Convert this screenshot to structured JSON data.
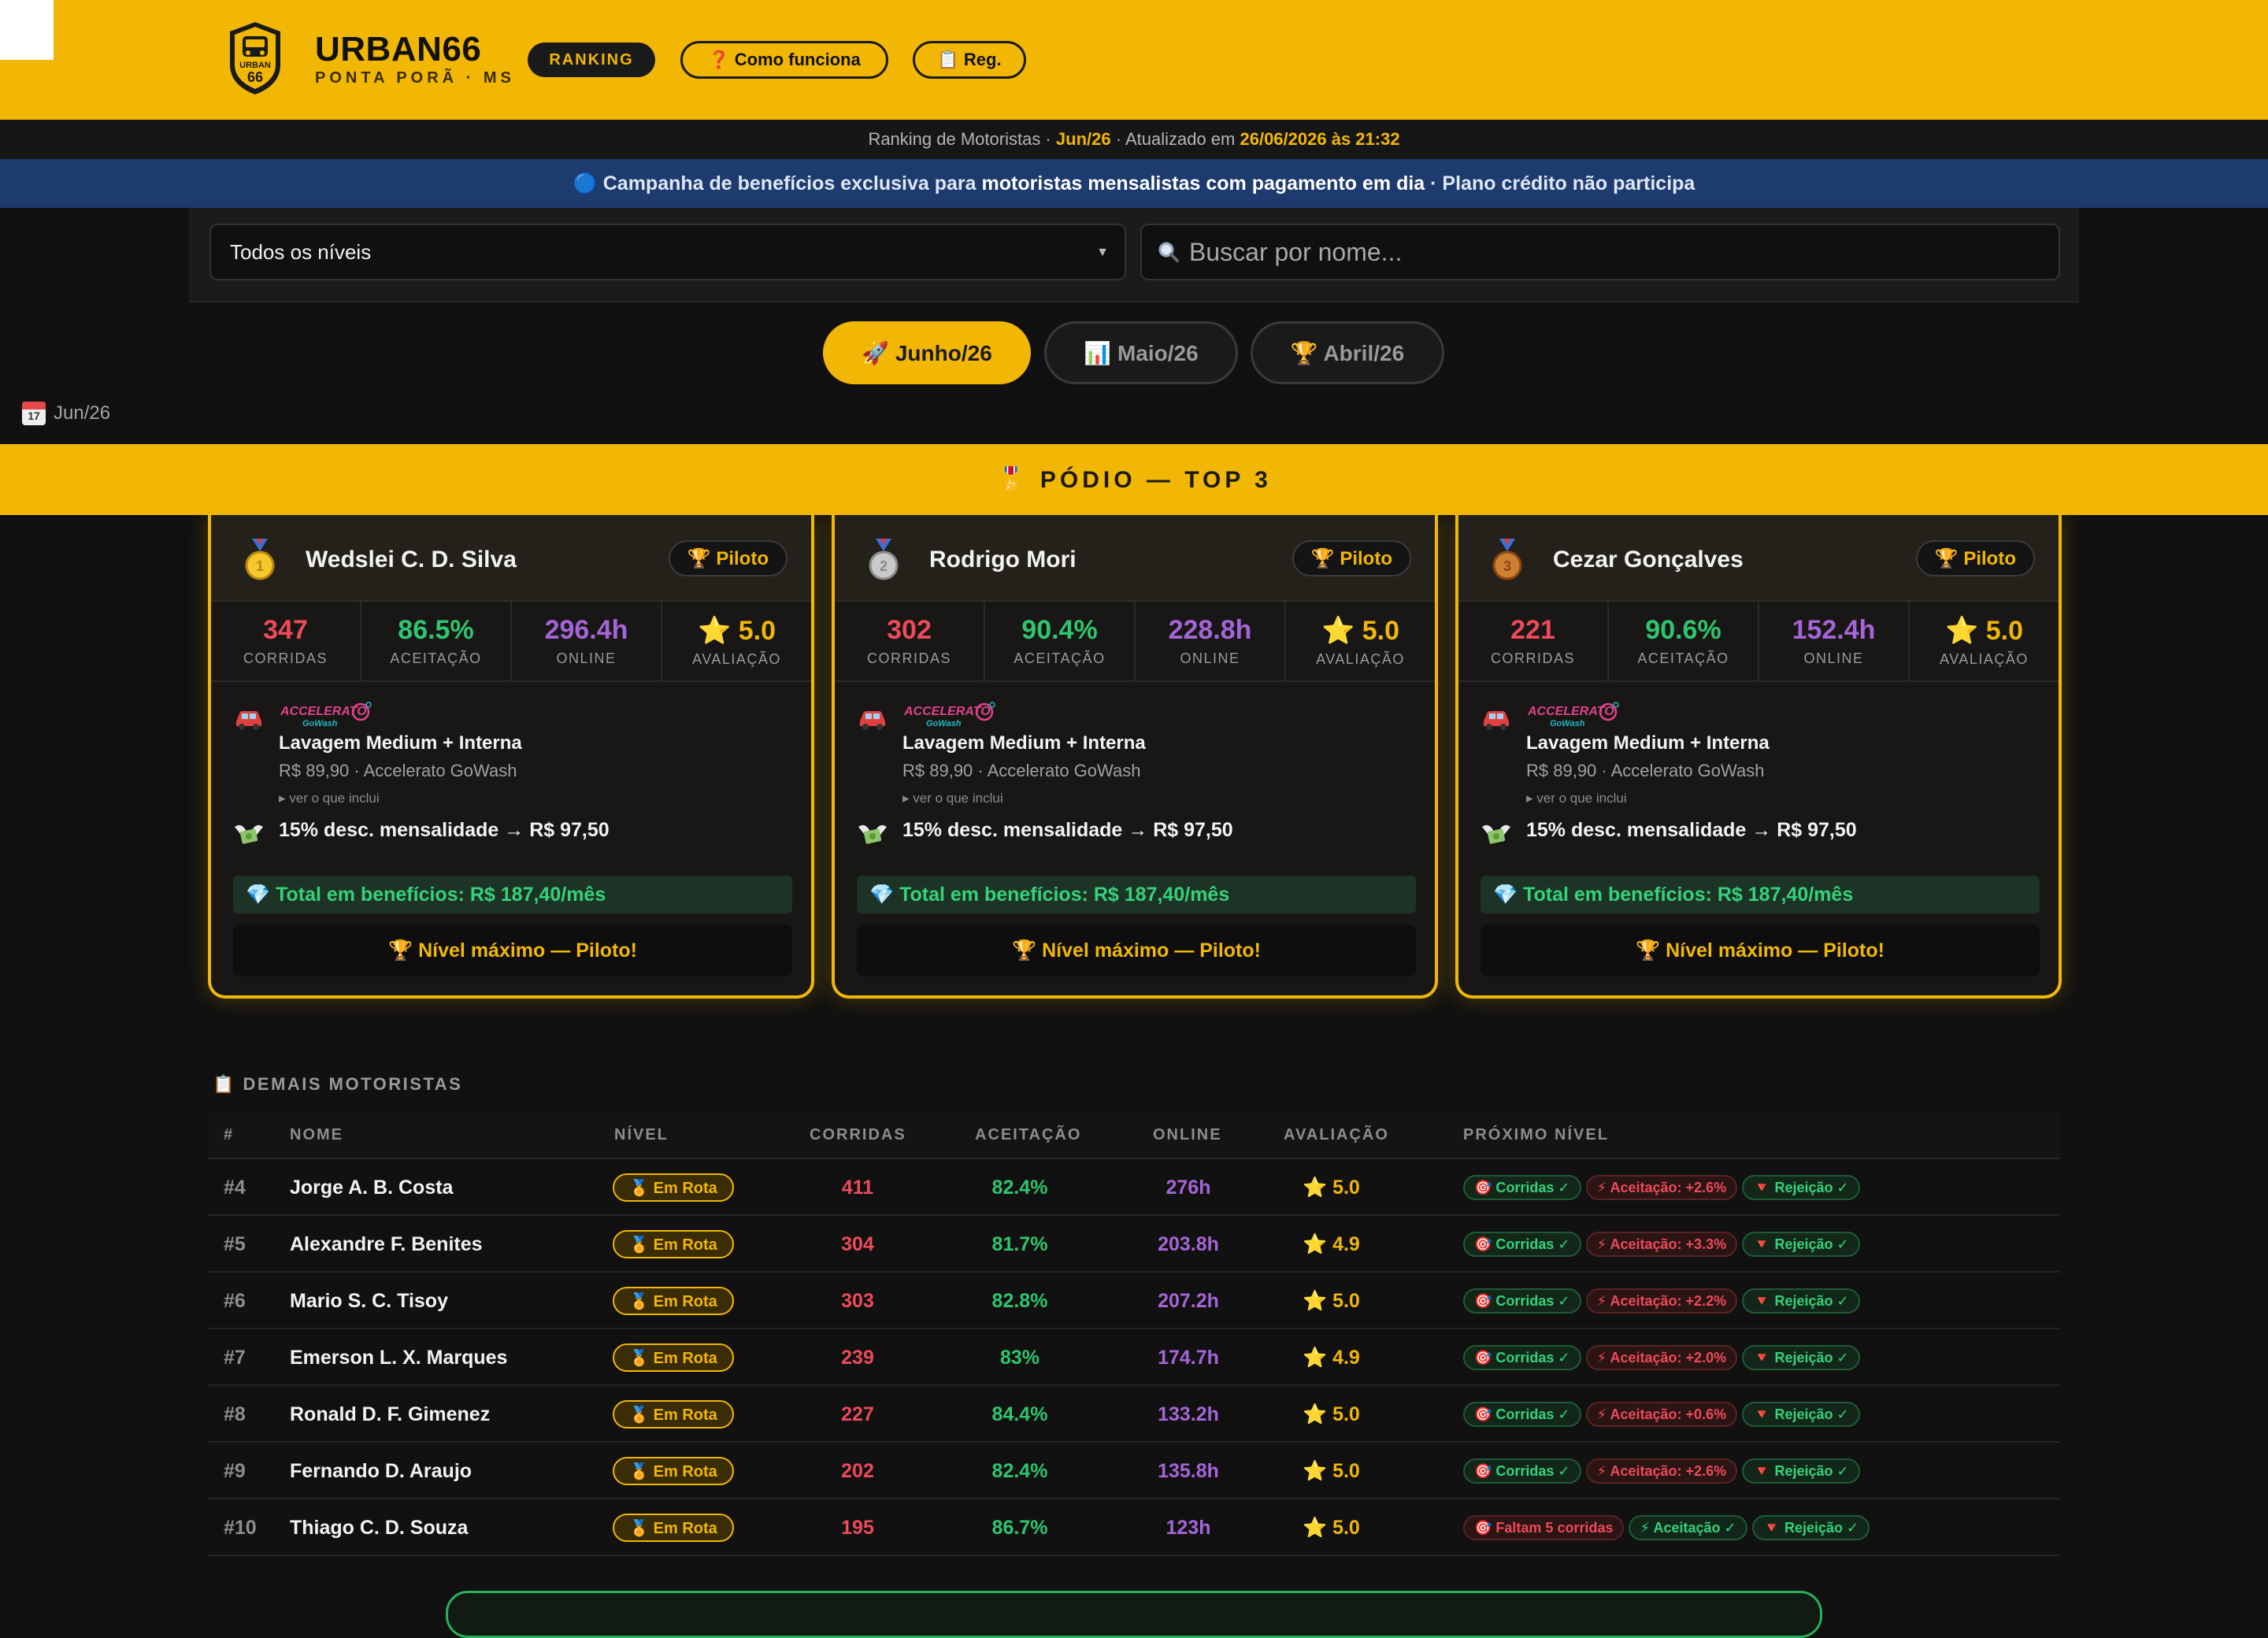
{
  "header": {
    "brand": "URBAN66",
    "subtitle": "PONTA PORÃ · MS",
    "logo_text": "URBAN",
    "logo_num": "66",
    "ranking_label": "RANKING",
    "como_label": "❓ Como funciona",
    "reg_label": "📋 Reg."
  },
  "infobar": {
    "prefix": "Ranking de Motoristas · ",
    "month": "Jun/26",
    "middle": " · Atualizado em ",
    "updated": "26/06/2026 às 21:32"
  },
  "campaign": {
    "icon": "🔵",
    "text_a": " Campanha de benefícios exclusiva para ",
    "text_b": "motoristas mensalistas com pagamento em dia",
    "text_c": " · Plano crédito não participa"
  },
  "filters": {
    "level_selected": "Todos os níveis",
    "search_placeholder": "Buscar por nome..."
  },
  "tabs": [
    {
      "label": "🚀 Junho/26",
      "active": true
    },
    {
      "label": "📊 Maio/26",
      "active": false
    },
    {
      "label": "🏆 Abril/26",
      "active": false
    }
  ],
  "month_tag": {
    "cal_day": "17",
    "label": "Jun/26"
  },
  "podium": {
    "title": "🎖️ PÓDIO — TOP 3",
    "stat_labels": [
      "CORRIDAS",
      "ACEITAÇÃO",
      "ONLINE",
      "AVALIAÇÃO"
    ],
    "cards": [
      {
        "medal": "1",
        "name": "Wedslei C. D. Silva",
        "badge": "🏆 Piloto",
        "corridas": "347",
        "aceitacao": "86.5%",
        "online": "296.4h",
        "avaliacao": "⭐ 5.0",
        "ben_title": "Lavagem Medium + Interna",
        "ben_price": "R$ 89,90 · Accelerato GoWash",
        "ben_link": "▸ ver o que inclui",
        "ben_disc": "15% desc. mensalidade → R$ 97,50",
        "total": "💎 Total em benefícios: R$ 187,40/mês",
        "max": "🏆 Nível máximo — Piloto!"
      },
      {
        "medal": "2",
        "name": "Rodrigo Mori",
        "badge": "🏆 Piloto",
        "corridas": "302",
        "aceitacao": "90.4%",
        "online": "228.8h",
        "avaliacao": "⭐ 5.0",
        "ben_title": "Lavagem Medium + Interna",
        "ben_price": "R$ 89,90 · Accelerato GoWash",
        "ben_link": "▸ ver o que inclui",
        "ben_disc": "15% desc. mensalidade → R$ 97,50",
        "total": "💎 Total em benefícios: R$ 187,40/mês",
        "max": "🏆 Nível máximo — Piloto!"
      },
      {
        "medal": "3",
        "name": "Cezar Gonçalves",
        "badge": "🏆 Piloto",
        "corridas": "221",
        "aceitacao": "90.6%",
        "online": "152.4h",
        "avaliacao": "⭐ 5.0",
        "ben_title": "Lavagem Medium + Interna",
        "ben_price": "R$ 89,90 · Accelerato GoWash",
        "ben_link": "▸ ver o que inclui",
        "ben_disc": "15% desc. mensalidade → R$ 97,50",
        "total": "💎 Total em benefícios: R$ 187,40/mês",
        "max": "🏆 Nível máximo — Piloto!"
      }
    ],
    "partner_logo": "ACCELERATO",
    "partner_sub": "GoWash"
  },
  "table": {
    "section_title": "📋 DEMAIS MOTORISTAS",
    "headers": [
      "#",
      "NOME",
      "NÍVEL",
      "CORRIDAS",
      "ACEITAÇÃO",
      "ONLINE",
      "AVALIAÇÃO",
      "PRÓXIMO NÍVEL"
    ],
    "rows": [
      {
        "rank": "#4",
        "name": "Jorge A. B. Costa",
        "level": "🏅 Em Rota",
        "corridas": "411",
        "aceitacao": "82.4%",
        "online": "276h",
        "avaliacao": "⭐ 5.0",
        "chips": [
          {
            "text": "🎯 Corridas ✓",
            "ok": true
          },
          {
            "text": "⚡ Aceitação: +2.6%",
            "ok": false
          },
          {
            "text": "🔻 Rejeição ✓",
            "ok": true
          }
        ]
      },
      {
        "rank": "#5",
        "name": "Alexandre F. Benites",
        "level": "🏅 Em Rota",
        "corridas": "304",
        "aceitacao": "81.7%",
        "online": "203.8h",
        "avaliacao": "⭐ 4.9",
        "chips": [
          {
            "text": "🎯 Corridas ✓",
            "ok": true
          },
          {
            "text": "⚡ Aceitação: +3.3%",
            "ok": false
          },
          {
            "text": "🔻 Rejeição ✓",
            "ok": true
          }
        ]
      },
      {
        "rank": "#6",
        "name": "Mario S. C. Tisoy",
        "level": "🏅 Em Rota",
        "corridas": "303",
        "aceitacao": "82.8%",
        "online": "207.2h",
        "avaliacao": "⭐ 5.0",
        "chips": [
          {
            "text": "🎯 Corridas ✓",
            "ok": true
          },
          {
            "text": "⚡ Aceitação: +2.2%",
            "ok": false
          },
          {
            "text": "🔻 Rejeição ✓",
            "ok": true
          }
        ]
      },
      {
        "rank": "#7",
        "name": "Emerson L. X. Marques",
        "level": "🏅 Em Rota",
        "corridas": "239",
        "aceitacao": "83%",
        "online": "174.7h",
        "avaliacao": "⭐ 4.9",
        "chips": [
          {
            "text": "🎯 Corridas ✓",
            "ok": true
          },
          {
            "text": "⚡ Aceitação: +2.0%",
            "ok": false
          },
          {
            "text": "🔻 Rejeição ✓",
            "ok": true
          }
        ]
      },
      {
        "rank": "#8",
        "name": "Ronald D. F. Gimenez",
        "level": "🏅 Em Rota",
        "corridas": "227",
        "aceitacao": "84.4%",
        "online": "133.2h",
        "avaliacao": "⭐ 5.0",
        "chips": [
          {
            "text": "🎯 Corridas ✓",
            "ok": true
          },
          {
            "text": "⚡ Aceitação: +0.6%",
            "ok": false
          },
          {
            "text": "🔻 Rejeição ✓",
            "ok": true
          }
        ]
      },
      {
        "rank": "#9",
        "name": "Fernando D. Araujo",
        "level": "🏅 Em Rota",
        "corridas": "202",
        "aceitacao": "82.4%",
        "online": "135.8h",
        "avaliacao": "⭐ 5.0",
        "chips": [
          {
            "text": "🎯 Corridas ✓",
            "ok": true
          },
          {
            "text": "⚡ Aceitação: +2.6%",
            "ok": false
          },
          {
            "text": "🔻 Rejeição ✓",
            "ok": true
          }
        ]
      },
      {
        "rank": "#10",
        "name": "Thiago C. D. Souza",
        "level": "🏅 Em Rota",
        "corridas": "195",
        "aceitacao": "86.7%",
        "online": "123h",
        "avaliacao": "⭐ 5.0",
        "chips": [
          {
            "text": "🎯 Faltam 5 corridas",
            "ok": false
          },
          {
            "text": "⚡ Aceitação ✓",
            "ok": true
          },
          {
            "text": "🔻 Rejeição ✓",
            "ok": true
          }
        ]
      }
    ]
  },
  "colors": {
    "accent": "#f2b705",
    "campaign_bg": "#1d3b6e",
    "red": "#ee4a5a",
    "green": "#2ec66e",
    "purple": "#a565d8"
  }
}
